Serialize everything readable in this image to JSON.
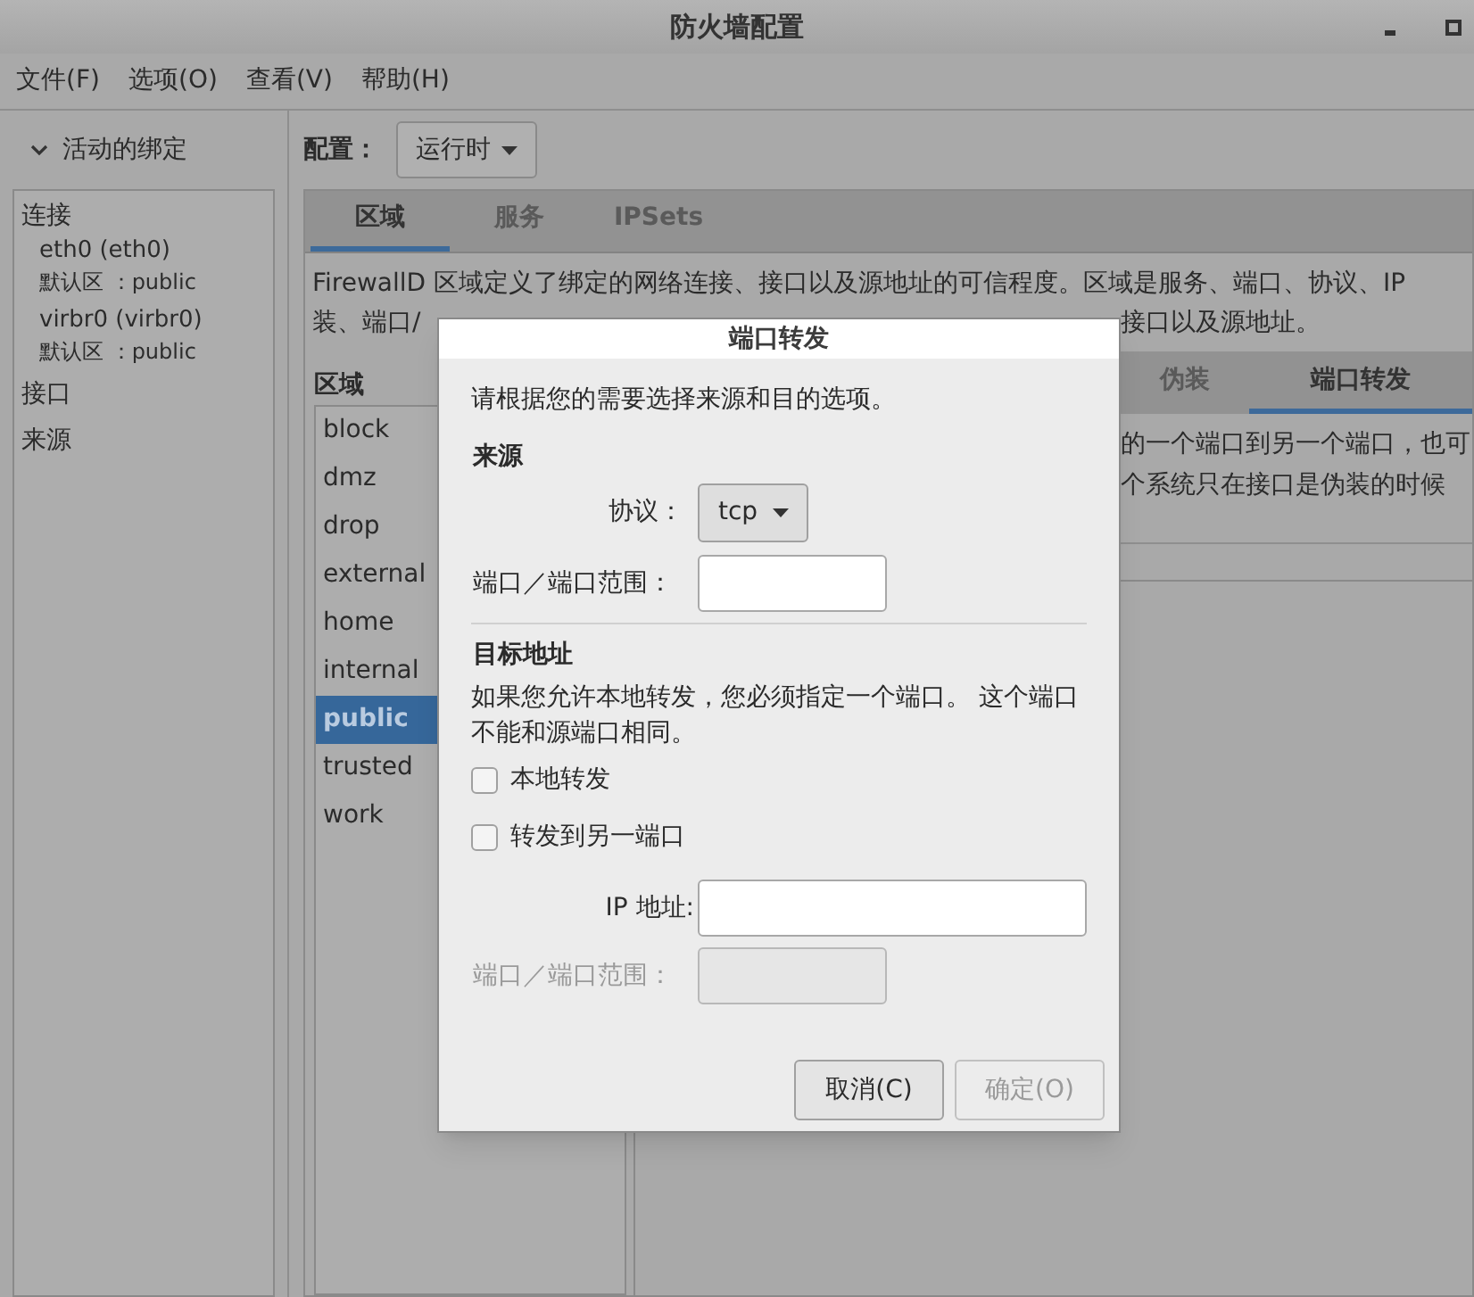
{
  "window": {
    "title": "防火墙配置"
  },
  "menu": [
    "文件(F)",
    "选项(O)",
    "查看(V)",
    "帮助(H)"
  ],
  "bindings": {
    "title": "活动的绑定",
    "expanded": true,
    "sections": [
      {
        "label": "连接",
        "children": [
          {
            "name": "eth0 (eth0)",
            "zone": "默认区 ：public"
          },
          {
            "name": "virbr0 (virbr0)",
            "zone": "默认区 ：public"
          }
        ]
      },
      {
        "label": "接口"
      },
      {
        "label": "来源"
      }
    ]
  },
  "config": {
    "label": "配置：",
    "value": "运行时"
  },
  "tabs": [
    {
      "label": "区域",
      "selected": true
    },
    {
      "label": "服务",
      "selected": false
    },
    {
      "label": "IPSets",
      "selected": false
    }
  ],
  "description": {
    "line_1": "FirewallD 区域定义了绑定的网络连接、接口以及源地址的可信程度。区域是服务、端口、协议、IP",
    "line_2_start": "装、端口/",
    "line_2_end": "接口以及源地址。"
  },
  "zones": {
    "label": "区域",
    "items": [
      {
        "name": "block",
        "selected": false
      },
      {
        "name": "dmz",
        "selected": false
      },
      {
        "name": "drop",
        "selected": false
      },
      {
        "name": "external",
        "selected": false
      },
      {
        "name": "home",
        "selected": false
      },
      {
        "name": "internal",
        "selected": false
      },
      {
        "name": "public",
        "selected": true
      },
      {
        "name": "trusted",
        "selected": false
      },
      {
        "name": "work",
        "selected": false
      }
    ]
  },
  "zone_tabs": [
    {
      "label": "伪装",
      "selected": false
    },
    {
      "label": "端口转发",
      "selected": true
    }
  ],
  "zone_text": [
    "的一个端口到另一个端口，也可",
    "个系统只在接口是伪装的时候"
  ],
  "dialog": {
    "title": "端口转发",
    "intro": "请根据您的需要选择来源和目的选项。",
    "source": {
      "heading": "来源",
      "protocol_label": "协议：",
      "protocol": "tcp",
      "port_label": "端口／端口范围：",
      "port_disabled": false
    },
    "destination": {
      "heading": "目标地址",
      "note": "如果您允许本地转发，您必须指定一个端口。 这个端口不能和源端口相同。",
      "checkboxes": [
        {
          "label": "本地转发",
          "checked": false
        },
        {
          "label": "转发到另一端口",
          "checked": false
        }
      ],
      "ip_label": "IP 地址:",
      "ip_disabled": false,
      "port_label": "端口／端口范围：",
      "port_disabled": true
    },
    "buttons": [
      {
        "label": "取消(C)",
        "disabled": false
      },
      {
        "label": "确定(O)",
        "disabled": true
      }
    ]
  }
}
